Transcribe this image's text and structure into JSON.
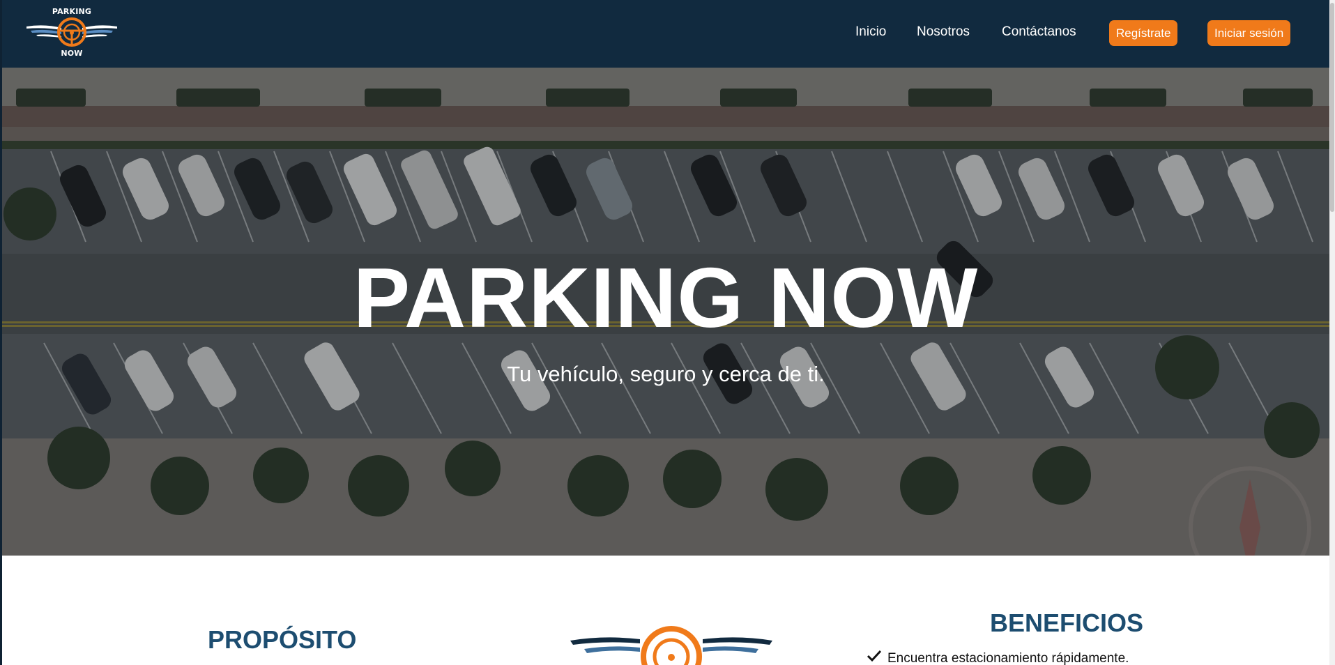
{
  "logo": {
    "brand_top": "PARKING",
    "brand_bottom": "NOW",
    "icon": "steering-wheel-wings-icon"
  },
  "nav": {
    "items": [
      {
        "label": "Inicio"
      },
      {
        "label": "Nosotros"
      },
      {
        "label": "Contáctanos"
      }
    ],
    "register_label": "Regístrate",
    "login_label": "Iniciar sesión"
  },
  "hero": {
    "title": "PARKING NOW",
    "subtitle": "Tu vehículo, seguro y cerca de ti."
  },
  "sections": {
    "purpose_title": "PROPÓSITO",
    "benefits_title": "BENEFICIOS",
    "benefits": [
      {
        "icon": "check-icon",
        "text": "Encuentra estacionamiento rápidamente."
      }
    ]
  },
  "colors": {
    "navbar": "#112a3f",
    "accent": "#f07a1a",
    "heading": "#1d4d70"
  }
}
